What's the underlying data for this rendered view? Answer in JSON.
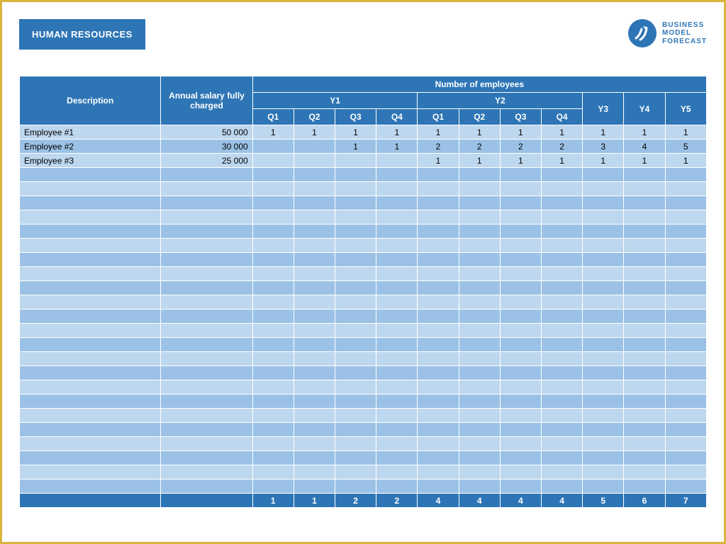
{
  "title": "HUMAN RESOURCES",
  "logo": {
    "line1": "BUSINESS",
    "line2": "MODEL",
    "line3": "FORECAST"
  },
  "headers": {
    "description": "Description",
    "salary": "Annual salary fully charged",
    "group": "Number of employees",
    "y1": "Y1",
    "y2": "Y2",
    "y3": "Y3",
    "y4": "Y4",
    "y5": "Y5",
    "q1": "Q1",
    "q2": "Q2",
    "q3": "Q3",
    "q4": "Q4"
  },
  "rows": [
    {
      "desc": "Employee #1",
      "salary": "50 000",
      "v": [
        "1",
        "1",
        "1",
        "1",
        "1",
        "1",
        "1",
        "1",
        "1",
        "1",
        "1"
      ]
    },
    {
      "desc": "Employee #2",
      "salary": "30 000",
      "v": [
        "",
        "",
        "1",
        "1",
        "2",
        "2",
        "2",
        "2",
        "3",
        "4",
        "5"
      ]
    },
    {
      "desc": "Employee #3",
      "salary": "25 000",
      "v": [
        "",
        "",
        "",
        "",
        "1",
        "1",
        "1",
        "1",
        "1",
        "1",
        "1"
      ]
    }
  ],
  "blank_rows": 23,
  "totals": [
    "1",
    "1",
    "2",
    "2",
    "4",
    "4",
    "4",
    "4",
    "5",
    "6",
    "7"
  ],
  "chart_data": {
    "type": "table",
    "title": "Number of employees",
    "columns": [
      "Y1 Q1",
      "Y1 Q2",
      "Y1 Q3",
      "Y1 Q4",
      "Y2 Q1",
      "Y2 Q2",
      "Y2 Q3",
      "Y2 Q4",
      "Y3",
      "Y4",
      "Y5"
    ],
    "series": [
      {
        "name": "Employee #1",
        "salary": 50000,
        "values": [
          1,
          1,
          1,
          1,
          1,
          1,
          1,
          1,
          1,
          1,
          1
        ]
      },
      {
        "name": "Employee #2",
        "salary": 30000,
        "values": [
          0,
          0,
          1,
          1,
          2,
          2,
          2,
          2,
          3,
          4,
          5
        ]
      },
      {
        "name": "Employee #3",
        "salary": 25000,
        "values": [
          0,
          0,
          0,
          0,
          1,
          1,
          1,
          1,
          1,
          1,
          1
        ]
      }
    ],
    "totals": [
      1,
      1,
      2,
      2,
      4,
      4,
      4,
      4,
      5,
      6,
      7
    ]
  }
}
